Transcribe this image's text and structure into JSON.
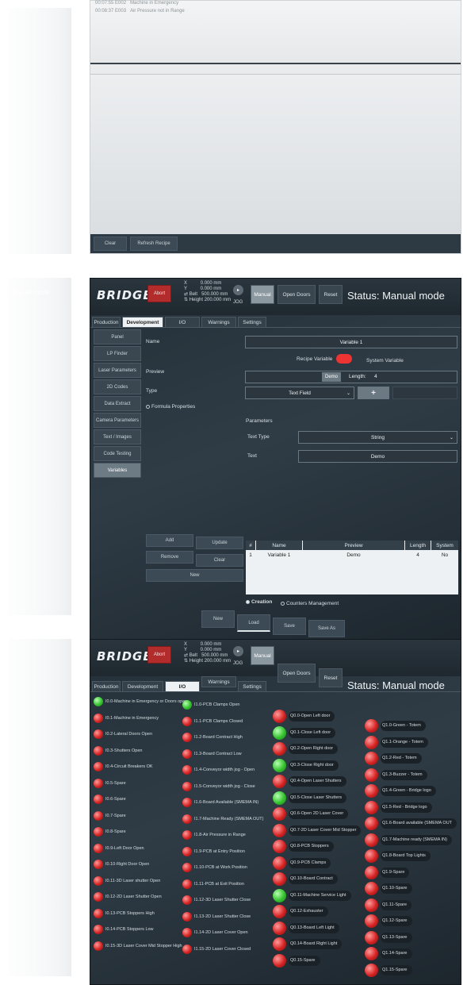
{
  "panel1": {
    "log_lines": [
      {
        "time": "00:07:55",
        "code": "E002",
        "msg": "Machine in Emergency"
      },
      {
        "time": "00:08:37",
        "code": "E003",
        "msg": "Air Pressure not in Range"
      }
    ],
    "buttons": {
      "clear": "Clear",
      "refresh": "Refresh Recipe"
    }
  },
  "header": {
    "logo": "BRIDGE",
    "abort": "Abort",
    "coords": {
      "x_label": "X",
      "x_value": "0.000 mm",
      "y_label": "Y",
      "y_value": "0.000 mm",
      "belt_label": "Belt",
      "belt_value": "500.000 mm",
      "height_label": "Height",
      "height_value": "200.000 mm"
    },
    "jog": "JOG",
    "manual": "Manual",
    "open_doors": "Open Doors",
    "reset": "Reset",
    "status": "Status: Manual mode"
  },
  "tabs": [
    "Production",
    "Development",
    "I/O",
    "Warnings",
    "Settings"
  ],
  "panel2": {
    "sidebar": [
      "Panel",
      "LP Finder",
      "Laser Parameters",
      "2D Codes",
      "Data Extract",
      "Camera Parameters",
      "Text / Images",
      "Code Testing",
      "Variables"
    ],
    "labels": {
      "name": "Name",
      "preview": "Preview",
      "type": "Type",
      "formula": "Formula Properties",
      "parameters": "Parameters",
      "text_type": "Text Type",
      "text": "Text"
    },
    "name_value": "Variable 1",
    "recipe_variable": "Recipe Variable",
    "system_variable": "System Variable",
    "demo_button": "Demo",
    "length_label": "Length:",
    "length_value": "4",
    "type_value": "Text Field",
    "plus": "+",
    "text_type_value": "String",
    "text_value": "Demo",
    "buttons": {
      "add": "Add",
      "update": "Update",
      "remove": "Remove",
      "clear": "Clear",
      "new": "New"
    },
    "table": {
      "headers": [
        "#",
        "Name",
        "Preview",
        "Length",
        "System"
      ],
      "rows": [
        [
          "1",
          "Variable 1",
          "Demo",
          "4",
          "No"
        ]
      ]
    },
    "modes": {
      "creation": "Creation",
      "counters": "Counters Management"
    },
    "footer": {
      "new": "New",
      "load": "Load",
      "save": "Save",
      "save_as": "Save As"
    }
  },
  "panel3": {
    "inputs_a": [
      {
        "label": "I0.0-Machine in Emergency or Doors open",
        "state": "on"
      },
      {
        "label": "I0.1-Machine in Emergency",
        "state": "off"
      },
      {
        "label": "I0.2-Lateral Doors Open",
        "state": "off"
      },
      {
        "label": "I0.3-Shutters Open",
        "state": "off"
      },
      {
        "label": "I0.4-Circuit Breakers OK",
        "state": "off"
      },
      {
        "label": "I0.5-Spare",
        "state": "off"
      },
      {
        "label": "I0.6-Spare",
        "state": "off"
      },
      {
        "label": "I0.7-Spare",
        "state": "off"
      },
      {
        "label": "I0.8-Spare",
        "state": "off"
      },
      {
        "label": "I0.9-Left Door Open",
        "state": "off"
      },
      {
        "label": "I0.10-Right Door Open",
        "state": "off"
      },
      {
        "label": "I0.11-3D Laser shutter Open",
        "state": "off"
      },
      {
        "label": "I0.12-2D Laser Shutter Open",
        "state": "off"
      },
      {
        "label": "I0.13-PCB Stoppers High",
        "state": "off"
      },
      {
        "label": "I0.14-PCB Stoppers Low",
        "state": "off"
      },
      {
        "label": "I0.15-3D Laser Cover Mid Stopper High",
        "state": "off"
      }
    ],
    "inputs_b": [
      {
        "label": "I1.0-PCB Clamps Open",
        "state": "on"
      },
      {
        "label": "I1.1-PCB Clamps Closed",
        "state": "off"
      },
      {
        "label": "I1.2-Board Contract High",
        "state": "off"
      },
      {
        "label": "I1.3-Board Contract Low",
        "state": "off"
      },
      {
        "label": "I1.4-Conveyor width jog - Open",
        "state": "off"
      },
      {
        "label": "I1.5-Conveyor width jog - Close",
        "state": "off"
      },
      {
        "label": "I1.6-Board Available (SMEMA IN)",
        "state": "off"
      },
      {
        "label": "I1.7-Machine Ready (SMEMA OUT)",
        "state": "off"
      },
      {
        "label": "I1.8-Air Pressure in Range",
        "state": "off"
      },
      {
        "label": "I1.9-PCB at Entry Position",
        "state": "off"
      },
      {
        "label": "I1.10-PCB at Work Position",
        "state": "off"
      },
      {
        "label": "I1.11-PCB at Exit Position",
        "state": "off"
      },
      {
        "label": "I1.12-3D Laser Shutter Close",
        "state": "off"
      },
      {
        "label": "I1.13-2D Laser Shutter Close",
        "state": "off"
      },
      {
        "label": "I1.14-2D Laser Cover Open",
        "state": "off"
      },
      {
        "label": "I1.15-2D Laser Cover Closed",
        "state": "off"
      }
    ],
    "outputs_a": [
      {
        "label": "Q0.0-Open Left door",
        "state": "off"
      },
      {
        "label": "Q0.1-Close Left door",
        "state": "on"
      },
      {
        "label": "Q0.2-Open Right door",
        "state": "off"
      },
      {
        "label": "Q0.3-Close Right door",
        "state": "on"
      },
      {
        "label": "Q0.4-Open Laser Shutters",
        "state": "off"
      },
      {
        "label": "Q0.5-Close Laser Shutters",
        "state": "on"
      },
      {
        "label": "Q0.6-Open 2D Laser Cover",
        "state": "off"
      },
      {
        "label": "Q0.7-2D Laser Cover Mid Stopper",
        "state": "off"
      },
      {
        "label": "Q0.8-PCB Stoppers",
        "state": "off"
      },
      {
        "label": "Q0.9-PCB Clamps",
        "state": "off"
      },
      {
        "label": "Q0.10-Board Contract",
        "state": "off"
      },
      {
        "label": "Q0.11-Machine Service Light",
        "state": "on"
      },
      {
        "label": "Q0.12-Exhauster",
        "state": "off"
      },
      {
        "label": "Q0.13-Board Left Light",
        "state": "off"
      },
      {
        "label": "Q0.14-Board Right Light",
        "state": "off"
      },
      {
        "label": "Q0.15-Spare",
        "state": "off"
      }
    ],
    "outputs_b": [
      {
        "label": "Q1.0-Green - Totem",
        "state": "off"
      },
      {
        "label": "Q1.1-Orange - Totem",
        "state": "off"
      },
      {
        "label": "Q1.2-Red - Totem",
        "state": "off"
      },
      {
        "label": "Q1.3-Buzzer - Totem",
        "state": "off"
      },
      {
        "label": "Q1.4-Green - Bridge logo",
        "state": "off"
      },
      {
        "label": "Q1.5-Red - Bridge logo",
        "state": "off"
      },
      {
        "label": "Q1.6-Board available (SMEMA OUT",
        "state": "off"
      },
      {
        "label": "Q1.7-Machine ready (SMEMA IN)",
        "state": "off"
      },
      {
        "label": "Q1.8-Board Top Lights",
        "state": "off"
      },
      {
        "label": "Q1.9-Spare",
        "state": "off"
      },
      {
        "label": "Q1.10-Spare",
        "state": "off"
      },
      {
        "label": "Q1.11-Spare",
        "state": "off"
      },
      {
        "label": "Q1.12-Spare",
        "state": "off"
      },
      {
        "label": "Q1.13-Spare",
        "state": "off"
      },
      {
        "label": "Q1.14-Spare",
        "state": "off"
      },
      {
        "label": "Q1.15-Spare",
        "state": "off"
      }
    ]
  },
  "ghost": {
    "mode_title": "Manual mode"
  },
  "colors": {
    "abort": "#b32c2c",
    "led_on": "#35c22f",
    "led_off": "#d62424",
    "dark_bg": "#2b363e"
  }
}
